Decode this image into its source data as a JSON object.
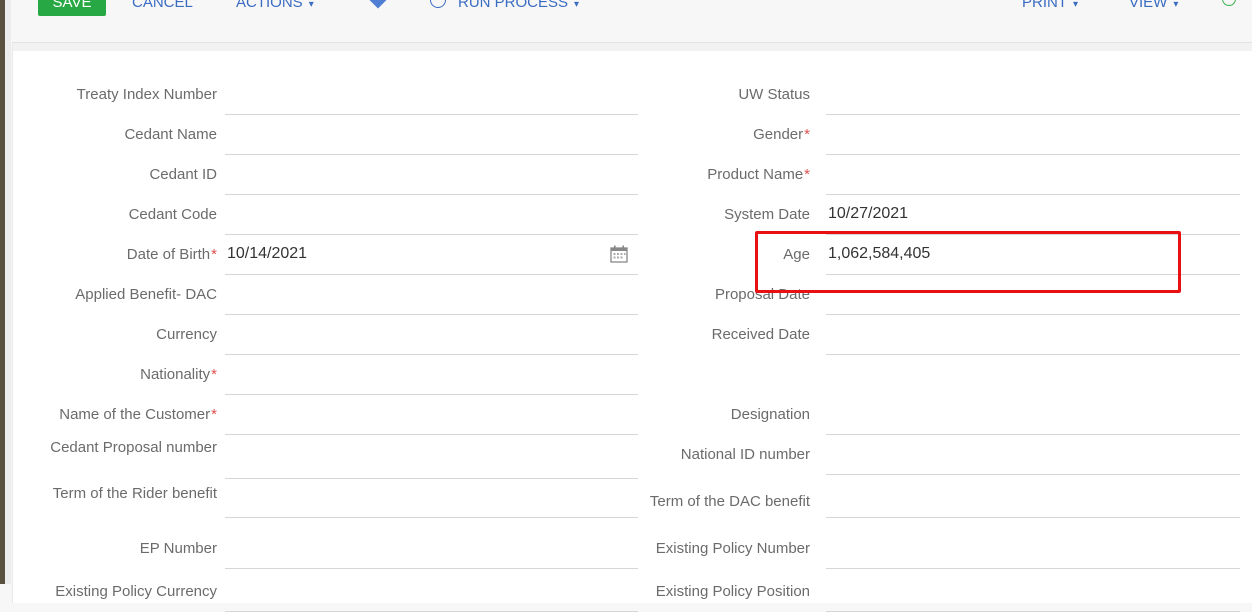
{
  "toolbar": {
    "save": "SAVE",
    "cancel": "CANCEL",
    "actions": "ACTIONS",
    "run_process": "RUN PROCESS",
    "print": "PRINT",
    "view": "VIEW"
  },
  "left": [
    {
      "label": "Treaty Index Number",
      "required": false,
      "value": ""
    },
    {
      "label": "Cedant Name",
      "required": false,
      "value": ""
    },
    {
      "label": "Cedant ID",
      "required": false,
      "value": ""
    },
    {
      "label": "Cedant Code",
      "required": false,
      "value": ""
    },
    {
      "label": "Date of Birth",
      "required": true,
      "value": "10/14/2021"
    },
    {
      "label": "Applied Benefit- DAC",
      "required": false,
      "value": ""
    },
    {
      "label": "Currency",
      "required": false,
      "value": ""
    },
    {
      "label": "Nationality",
      "required": true,
      "value": ""
    },
    {
      "label": "Name of the Customer",
      "required": true,
      "value": ""
    },
    {
      "label": "Cedant Proposal number",
      "required": false,
      "value": ""
    },
    {
      "label": "Term of the Rider benefit",
      "required": false,
      "value": ""
    },
    {
      "label": "EP Number",
      "required": false,
      "value": ""
    },
    {
      "label": "Existing Policy Currency",
      "required": false,
      "value": ""
    }
  ],
  "right": [
    {
      "label": "UW Status",
      "required": false,
      "value": ""
    },
    {
      "label": "Gender",
      "required": true,
      "value": ""
    },
    {
      "label": "Product Name",
      "required": true,
      "value": ""
    },
    {
      "label": "System Date",
      "required": false,
      "value": "10/27/2021"
    },
    {
      "label": "Age",
      "required": false,
      "value": "1,062,584,405"
    },
    {
      "label": "Proposal Date",
      "required": false,
      "value": ""
    },
    {
      "label": "Received Date",
      "required": false,
      "value": ""
    },
    {
      "label": "Designation",
      "required": false,
      "value": ""
    },
    {
      "label": "National ID number",
      "required": false,
      "value": ""
    },
    {
      "label": "Term of the DAC benefit",
      "required": false,
      "value": ""
    },
    {
      "label": "Existing Policy Number",
      "required": false,
      "value": ""
    },
    {
      "label": "Existing Policy Position",
      "required": false,
      "value": ""
    }
  ],
  "required_marker": "*",
  "icons": {
    "date_of_birth_picker": "calendar-icon"
  },
  "colors": {
    "save": "#27a844",
    "link": "#3a6cc2",
    "highlight": "#e81010",
    "required": "#e05050"
  }
}
